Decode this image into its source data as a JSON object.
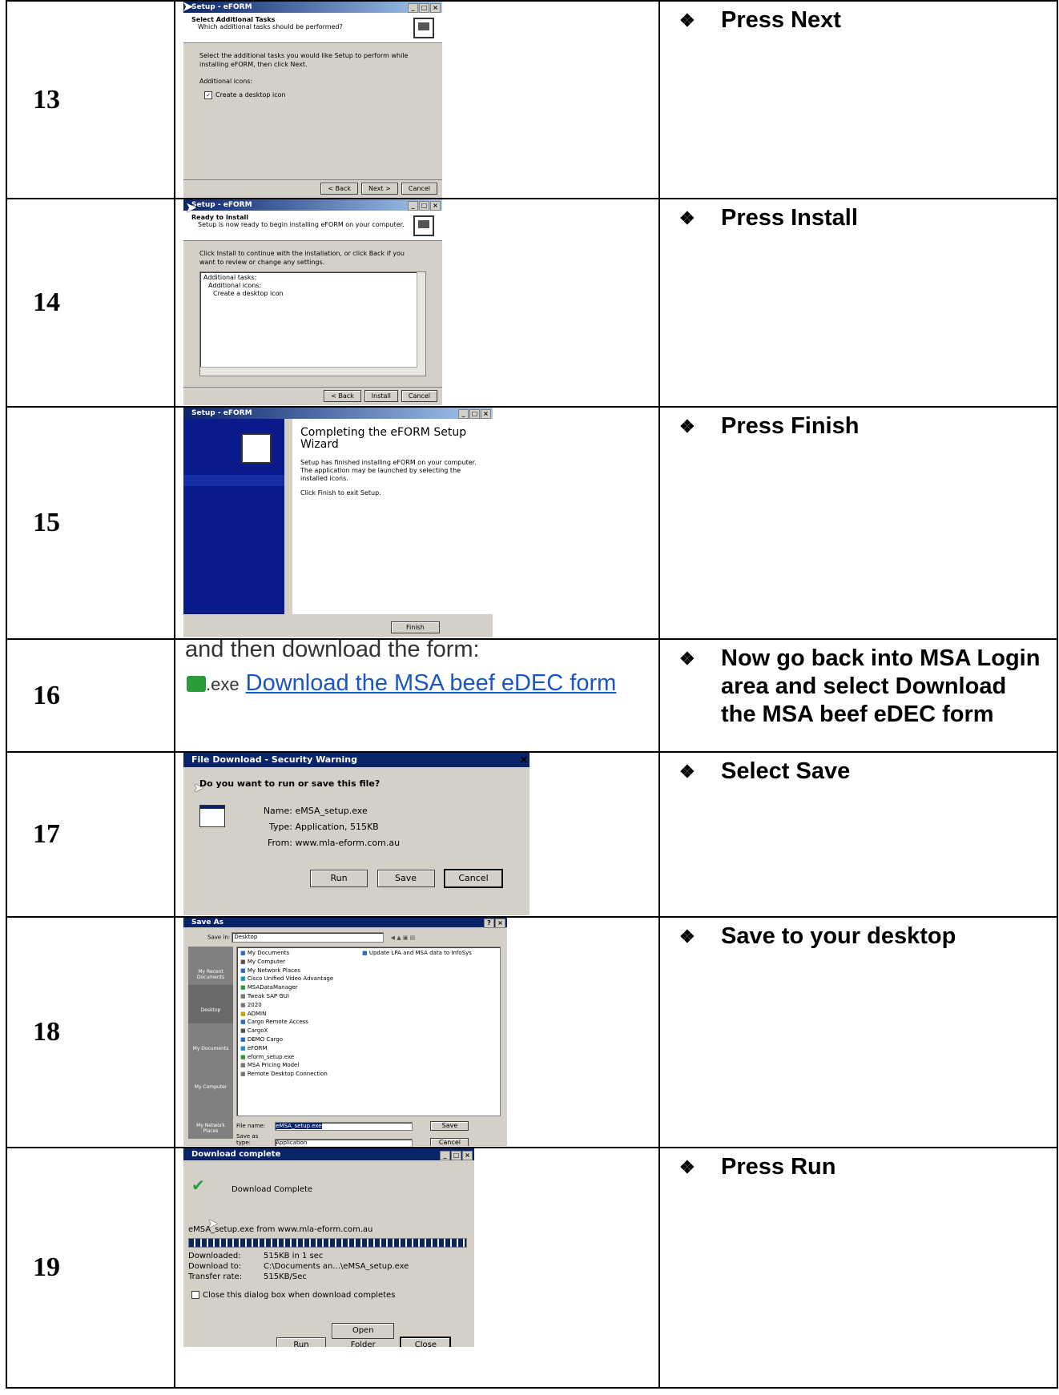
{
  "steps": [
    {
      "num": "13",
      "instruction": "Press Next",
      "dialog": {
        "title": "Setup - eFORM",
        "heading": "Select Additional Tasks",
        "subheading": "Which additional tasks should be performed?",
        "body": "Select the additional tasks you would like Setup to perform while installing eFORM, then click Next.",
        "group_label": "Additional icons:",
        "checkbox_label": "Create a desktop icon",
        "checked": true,
        "buttons": [
          "< Back",
          "Next >",
          "Cancel"
        ]
      }
    },
    {
      "num": "14",
      "instruction": "Press Install",
      "dialog": {
        "title": "Setup - eFORM",
        "heading": "Ready to Install",
        "subheading": "Setup is now ready to begin installing eFORM on your computer.",
        "body": "Click Install to continue with the installation, or click Back if you want to review or change any settings.",
        "memo": [
          "Additional tasks:",
          "Additional icons:",
          "Create a desktop icon"
        ],
        "buttons": [
          "< Back",
          "Install",
          "Cancel"
        ]
      }
    },
    {
      "num": "15",
      "instruction": "Press Finish",
      "dialog": {
        "title": "Setup - eFORM",
        "heading": "Completing the eFORM Setup Wizard",
        "body1": "Setup has finished installing eFORM on your computer. The application may be launched by selecting the installed icons.",
        "body2": "Click Finish to exit Setup.",
        "buttons": [
          "Finish"
        ]
      }
    },
    {
      "num": "16",
      "instruction": "Now go back into MSA Login area and select Download the MSA beef eDEC form",
      "web": {
        "line1": "and then download the form:",
        "ext": ".exe",
        "link": "Download the MSA beef eDEC form"
      }
    },
    {
      "num": "17",
      "instruction": "Select Save",
      "dialog": {
        "title": "File Download - Security Warning",
        "question": "Do you want to run or save this file?",
        "name_label": "Name:",
        "name": "eMSA_setup.exe",
        "type_label": "Type:",
        "type": "Application, 515KB",
        "from_label": "From:",
        "from": "www.mla-eform.com.au",
        "buttons": [
          "Run",
          "Save",
          "Cancel"
        ]
      }
    },
    {
      "num": "18",
      "instruction": "Save to your desktop",
      "dialog": {
        "title": "Save As",
        "save_in_label": "Save in:",
        "save_in": "Desktop",
        "places": [
          "My Recent Documents",
          "Desktop",
          "My Documents",
          "My Computer",
          "My Network Places"
        ],
        "files_col1": [
          "My Documents",
          "My Computer",
          "My Network Places",
          "Cisco Unified Video Advantage",
          "MSADataManager",
          "Tweak SAP GUI",
          "2020",
          "ADMIN",
          "Cargo Remote Access",
          "CargoX",
          "DEMO Cargo",
          "eFORM",
          "eform_setup.exe",
          "MSA Pricing Model",
          "Remote Desktop Connection"
        ],
        "files_col2": [
          "Update LPA and MSA data to InfoSys"
        ],
        "file_name_label": "File name:",
        "file_name": "eMSA_setup.exe",
        "save_type_label": "Save as type:",
        "save_type": "Application",
        "buttons": [
          "Save",
          "Cancel"
        ]
      }
    },
    {
      "num": "19",
      "instruction": "Press Run",
      "dialog": {
        "title": "Download complete",
        "heading": "Download Complete",
        "source": "eMSA_setup.exe from www.mla-eform.com.au",
        "rows": [
          [
            "Downloaded:",
            "515KB in 1 sec"
          ],
          [
            "Download to:",
            "C:\\Documents an...\\eMSA_setup.exe"
          ],
          [
            "Transfer rate:",
            "515KB/Sec"
          ]
        ],
        "checkbox_label": "Close this dialog box when download completes",
        "progress": 1.0,
        "buttons": [
          "Run",
          "Open Folder",
          "Close"
        ]
      }
    }
  ],
  "bullet_char": "❖"
}
